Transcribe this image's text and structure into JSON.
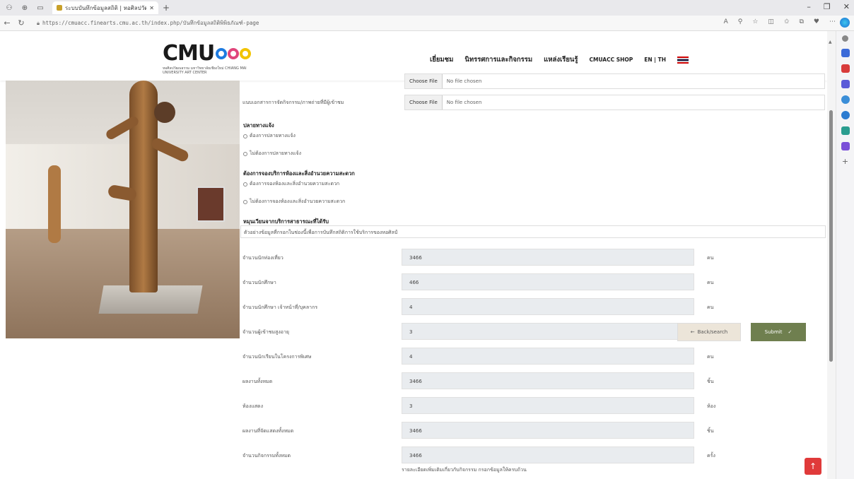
{
  "browser": {
    "tab_title": "ระบบบันทึกข้อมูลสถิติ | หอศิลปวัฒนธรรม มช.",
    "url": "https://cmuacc.finearts.cmu.ac.th/index.php/บันทึกข้อมูลสถิติพิพิธภัณฑ์-page",
    "new_tab": "+",
    "window_controls": [
      "–",
      "❐",
      "✕"
    ]
  },
  "header": {
    "logo_text": "CMU",
    "logo_sub": "หอศิลปวัฒนธรรม มหาวิทยาลัยเชียงใหม่ CHIANG MAI UNIVERSITY ART CENTER",
    "menu": [
      "เยี่ยมชม",
      "นิทรรศการและกิจกรรม",
      "แหล่งเรียนรู้",
      "CMUACC SHOP",
      "EN | TH"
    ]
  },
  "form": {
    "file_rows": [
      {
        "label": "",
        "button": "Choose File",
        "value": "No file chosen"
      },
      {
        "label": "แนบเอกสารการจัดกิจกรรม/ภาพถ่ายที่มีผู้เข้าชม",
        "button": "Choose File",
        "value": "No file chosen"
      }
    ],
    "section1": {
      "heading": "ปลายทางแจ้ง",
      "options": [
        "ต้องการปลายทางแจ้ง",
        "ไม่ต้องการปลายทางแจ้ง"
      ]
    },
    "section2": {
      "heading": "ต้องการจองบริการห้องและสิ่งอำนวยความสะดวก",
      "options": [
        "ต้องการจองห้องและสิ่งอำนวยความสะดวก",
        "ไม่ต้องการจองห้องและสิ่งอำนวยความสะดวก"
      ]
    },
    "section3": {
      "heading": "หมุนเวียนจากบริการสาธารณะที่ได้รับ",
      "value": "ตัวอย่างข้อมูลที่กรอกในช่องนี้เพื่อการบันทึกสถิติการใช้บริการของหอศิลป์"
    },
    "fields": [
      {
        "label": "จำนวนนักท่องเที่ยว",
        "value": "3466",
        "unit": "คน"
      },
      {
        "label": "จำนวนนักศึกษา",
        "value": "466",
        "unit": "คน"
      },
      {
        "label": "จำนวนนักศึกษา เจ้าหน้าที่/บุคลากร",
        "value": "4",
        "unit": "คน"
      },
      {
        "label": "จำนวนผู้เข้าชมสูงอายุ",
        "value": "3",
        "unit": ""
      },
      {
        "label": "จำนวนนักเรียนในโครงการพิเศษ",
        "value": "4",
        "unit": "คน"
      },
      {
        "label": "ผลงานทั้งหมด",
        "value": "3466",
        "unit": "ชิ้น"
      },
      {
        "label": "ห้องแสดง",
        "value": "3",
        "unit": "ห้อง"
      },
      {
        "label": "ผลงานที่จัดแสดงทั้งหมด",
        "value": "3466",
        "unit": "ชิ้น"
      },
      {
        "label": "จำนวนกิจกรรมทั้งหมด",
        "value": "3466",
        "unit": "ครั้ง"
      }
    ],
    "note": "รายละเอียดเพิ่มเติมเกี่ยวกับกิจกรรม กรอกข้อมูลให้ครบถ้วน",
    "back_label": "Back/search",
    "submit_label": "Submit"
  },
  "to_top_icon": "↑",
  "colors": {
    "submit": "#6f7f4f",
    "back": "#ece5d9",
    "to_top": "#e03a3a"
  }
}
